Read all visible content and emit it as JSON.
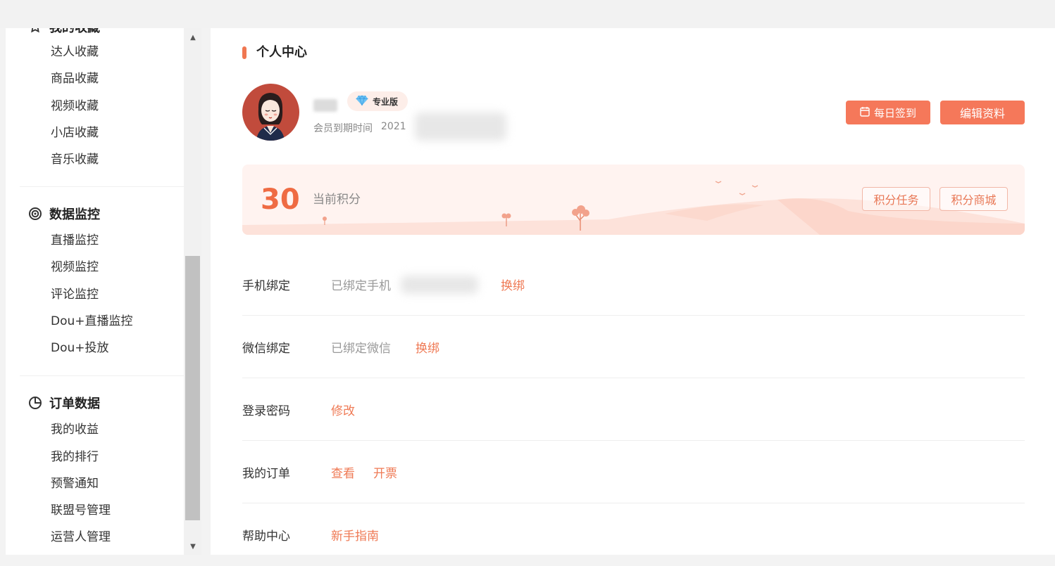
{
  "sidebar": {
    "groups": [
      {
        "title": "我的收藏",
        "icon": "star-icon",
        "items": [
          "达人收藏",
          "商品收藏",
          "视频收藏",
          "小店收藏",
          "音乐收藏"
        ]
      },
      {
        "title": "数据监控",
        "icon": "radar-icon",
        "items": [
          "直播监控",
          "视频监控",
          "评论监控",
          "Dou+直播监控",
          "Dou+投放"
        ]
      },
      {
        "title": "订单数据",
        "icon": "pie-chart-icon",
        "items": [
          "我的收益",
          "我的排行",
          "预警通知",
          "联盟号管理",
          "运营人管理"
        ]
      }
    ]
  },
  "scrollbar": {
    "up_icon": "arrow-up-icon",
    "down_icon": "arrow-down-icon"
  },
  "main": {
    "title": "个人中心",
    "profile": {
      "vip_badge": "专业版",
      "expire_label": "会员到期时间",
      "expire_value": "2021",
      "sign_button": "每日签到",
      "edit_button": "编辑资料"
    },
    "points": {
      "value": "30",
      "label": "当前积分",
      "task_button": "积分任务",
      "mall_button": "积分商城"
    },
    "rows": [
      {
        "label": "手机绑定",
        "value": "已绑定手机",
        "links": [
          "换绑"
        ]
      },
      {
        "label": "微信绑定",
        "value": "已绑定微信",
        "links": [
          "换绑"
        ]
      },
      {
        "label": "登录密码",
        "value": "",
        "links": [
          "修改"
        ]
      },
      {
        "label": "我的订单",
        "value": "",
        "links": [
          "查看",
          "开票"
        ]
      },
      {
        "label": "帮助中心",
        "value": "",
        "links": [
          "新手指南"
        ]
      }
    ]
  },
  "colors": {
    "accent": "#f5785a",
    "accent_text": "#ef7a55",
    "points_bg": "#fff3f0"
  }
}
